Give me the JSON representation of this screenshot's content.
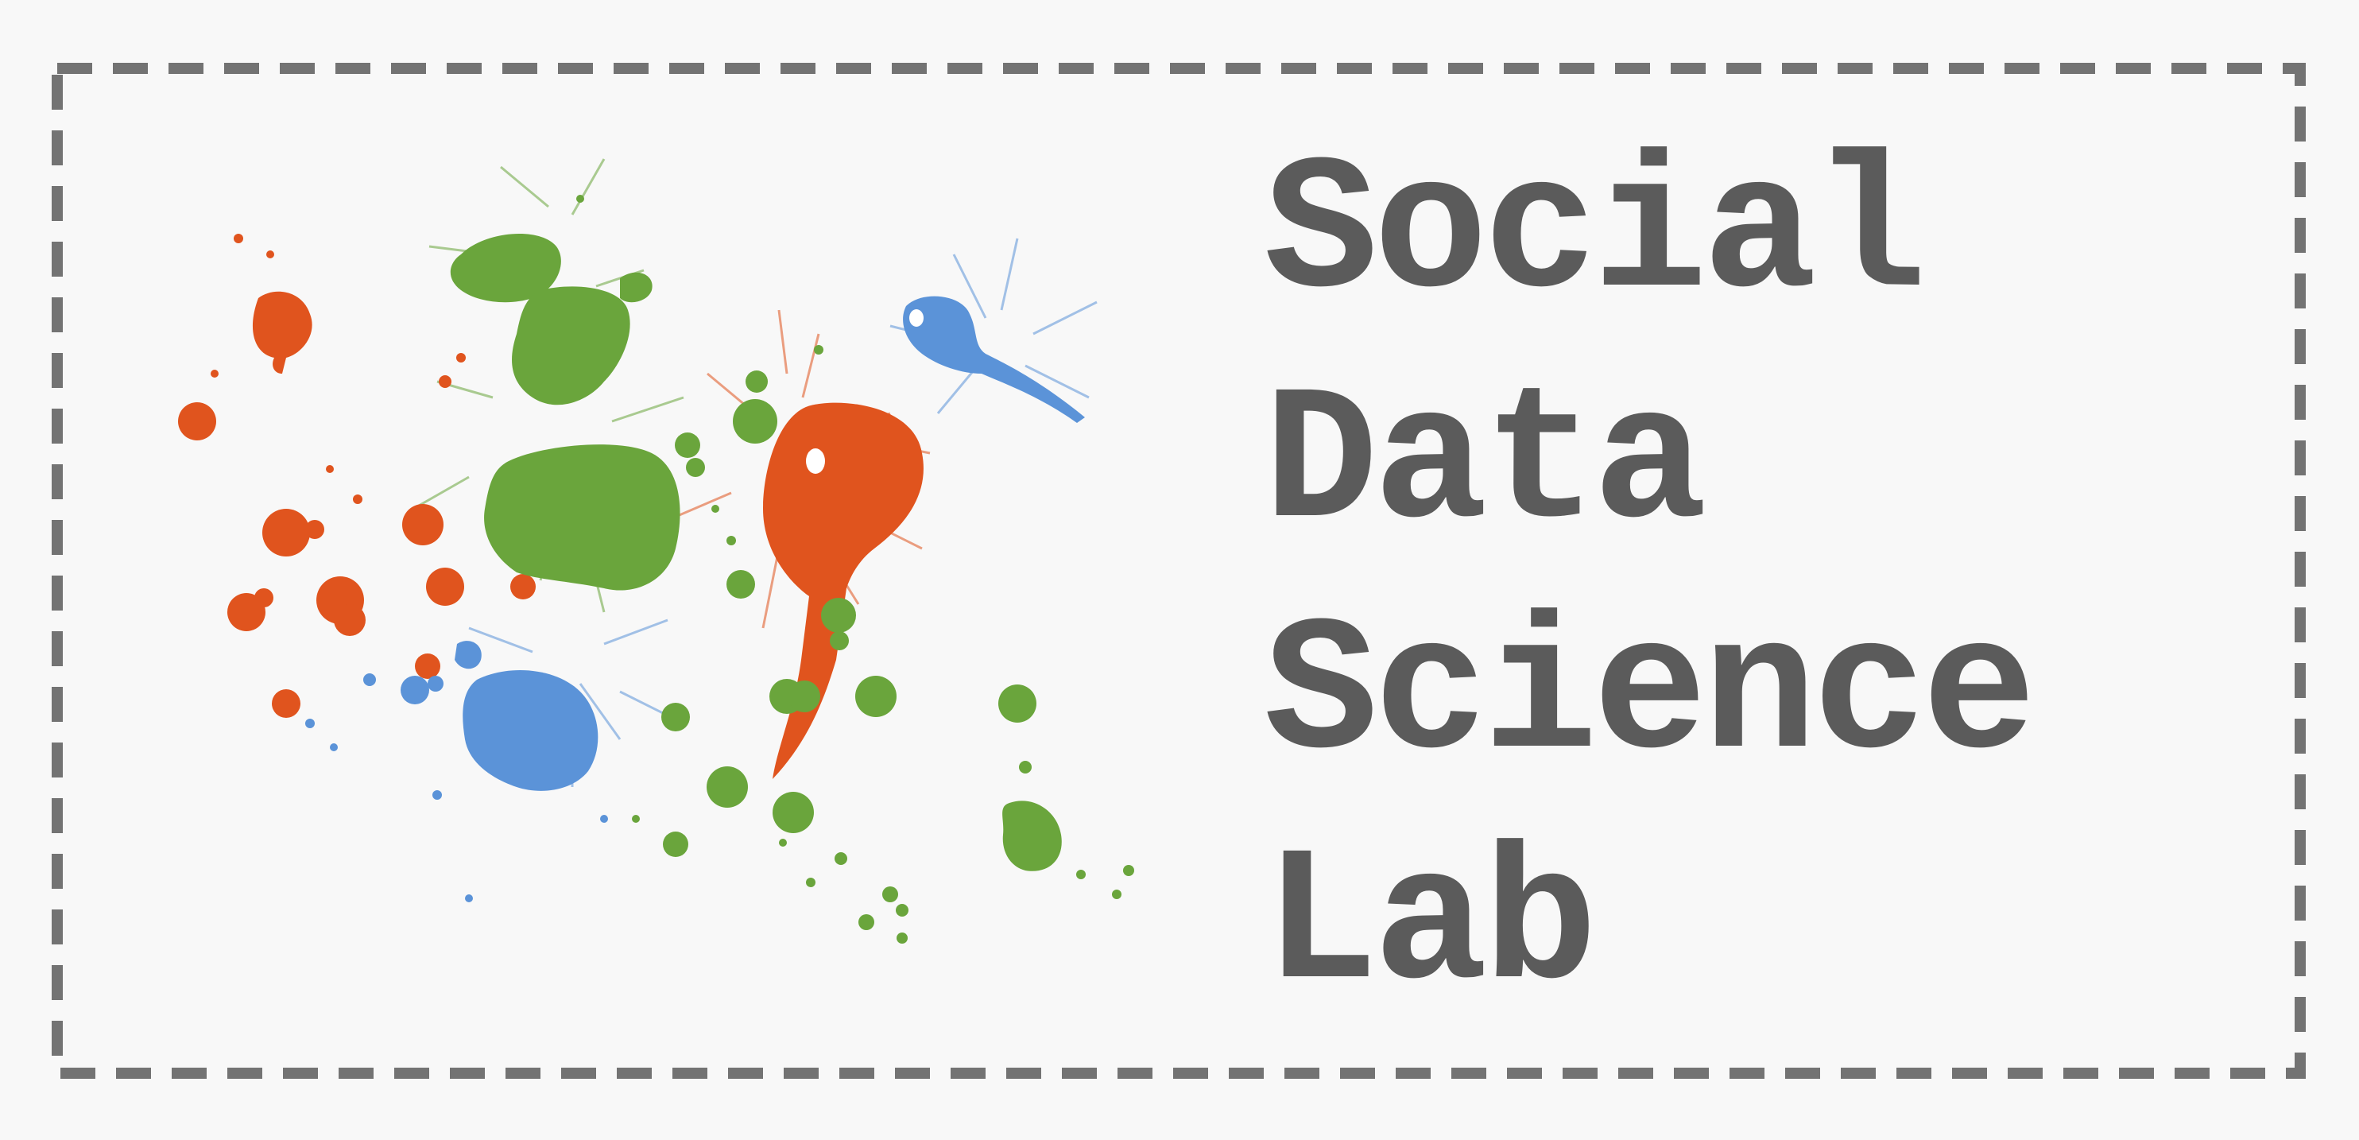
{
  "logo": {
    "lines": [
      "Social",
      "Data",
      "Science",
      "Lab"
    ]
  },
  "colors": {
    "text": "#5b5b5b",
    "border": "#737373",
    "orange": "#e0541e",
    "green": "#6aa53c",
    "blue": "#5b93d8",
    "background": "#f8f8f8"
  }
}
